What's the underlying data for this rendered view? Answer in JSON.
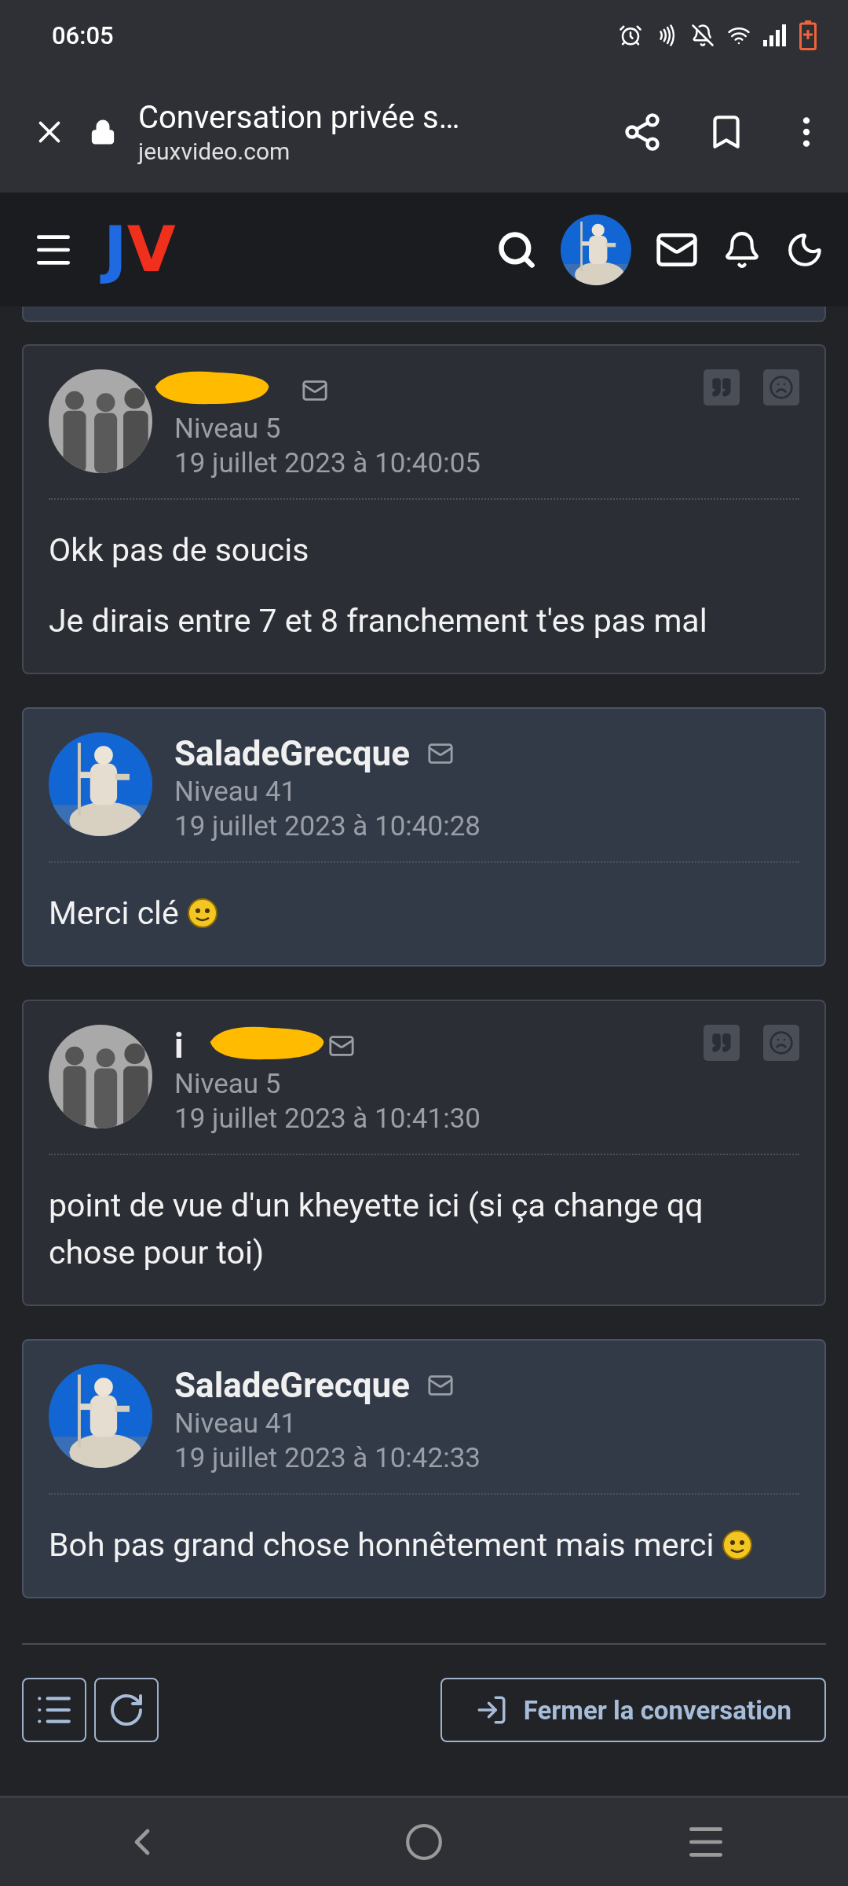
{
  "status_bar": {
    "time": "06:05"
  },
  "browser_bar": {
    "title": "Conversation privée s…",
    "url": "jeuxvideo.com"
  },
  "site_header": {
    "logo": [
      "J",
      "V"
    ]
  },
  "posts": [
    {
      "own": false,
      "redacted": true,
      "level": "Niveau 5",
      "date": "19 juillet 2023 à 10:40:05",
      "paragraphs": [
        "Okk pas de soucis",
        "Je dirais entre 7 et 8 franchement t'es pas mal"
      ],
      "smiley": false
    },
    {
      "own": true,
      "author": "SaladeGrecque",
      "level": "Niveau 41",
      "date": "19 juillet 2023 à 10:40:28",
      "paragraphs": [
        "Merci clé"
      ],
      "smiley": true
    },
    {
      "own": false,
      "redacted": true,
      "author": "i",
      "level": "Niveau 5",
      "date": "19 juillet 2023 à 10:41:30",
      "paragraphs": [
        "point de vue d'un kheyette ici (si ça change qq chose pour toi)"
      ],
      "smiley": false
    },
    {
      "own": true,
      "author": "SaladeGrecque",
      "level": "Niveau 41",
      "date": "19 juillet 2023 à 10:42:33",
      "paragraphs": [
        "Boh pas grand chose honnêtement mais merci"
      ],
      "smiley": true
    }
  ],
  "footer": {
    "close_button": "Fermer la conversation"
  }
}
